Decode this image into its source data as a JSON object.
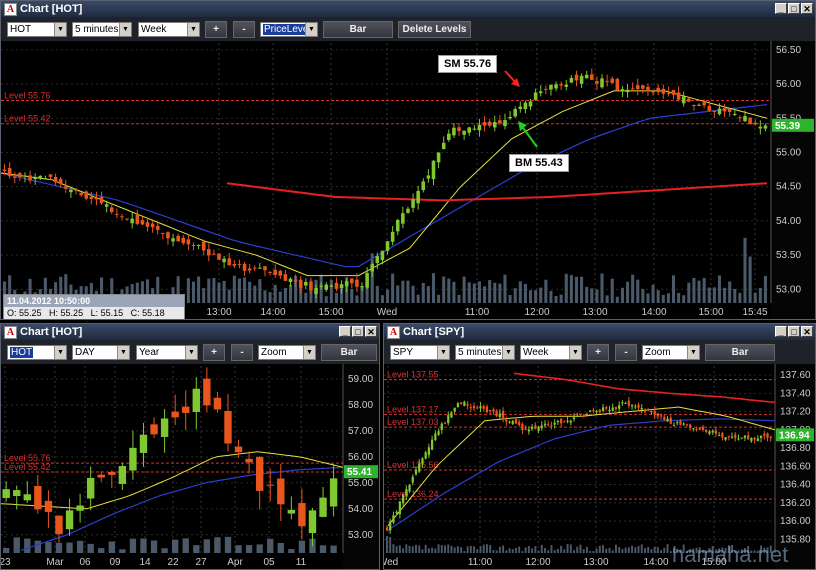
{
  "windows": {
    "main": {
      "title": "Chart [HOT]",
      "symbol": "HOT",
      "interval": "5 minutes",
      "range": "Week",
      "plus": "+",
      "minus": "-",
      "mode": "PriceLevel",
      "bar": "Bar",
      "delete": "Delete Levels",
      "price_ticks": [
        "56.50",
        "56.00",
        "55.50",
        "55.00",
        "54.50",
        "54.00",
        "53.50",
        "53.00"
      ],
      "price_tick_values": [
        56.5,
        56.0,
        55.5,
        55.0,
        54.5,
        54.0,
        53.5,
        53.0
      ],
      "time_ticks": [
        "13:00",
        "14:00",
        "15:00",
        "Wed",
        "11:00",
        "12:00",
        "13:00",
        "14:00",
        "15:00",
        "15:45"
      ],
      "levels": [
        {
          "label": "Level 55.76",
          "value": 55.76
        },
        {
          "label": "Level 55.42",
          "value": 55.42
        }
      ],
      "last_price": "55.39",
      "callout_sm": "SM 55.76",
      "callout_bm": "BM 55.43",
      "info": {
        "header": "11.04.2012 10:50:00",
        "o": "O: 55.25",
        "h": "H: 55.25",
        "l": "L: 55.15",
        "c": "C: 55.18"
      }
    },
    "bottom_left": {
      "title": "Chart [HOT]",
      "symbol": "HOT",
      "interval": "DAY",
      "range": "Year",
      "plus": "+",
      "minus": "-",
      "mode": "Zoom",
      "bar": "Bar",
      "price_ticks": [
        "59.00",
        "58.00",
        "57.00",
        "56.00",
        "55.00",
        "54.00",
        "53.00"
      ],
      "time_ticks": [
        "23",
        "Mar",
        "06",
        "09",
        "14",
        "22",
        "27",
        "Apr",
        "05",
        "11"
      ],
      "levels": [
        {
          "label": "Level 55.76",
          "value": 55.76
        },
        {
          "label": "Level 55.42",
          "value": 55.42
        }
      ],
      "last_price": "55.41"
    },
    "bottom_right": {
      "title": "Chart [SPY]",
      "symbol": "SPY",
      "interval": "5 minutes",
      "range": "Week",
      "plus": "+",
      "minus": "-",
      "mode": "Zoom",
      "bar": "Bar",
      "price_ticks": [
        "137.60",
        "137.40",
        "137.20",
        "137.00",
        "136.80",
        "136.60",
        "136.40",
        "136.20",
        "136.00",
        "135.80"
      ],
      "time_ticks": [
        "Wed",
        "11:00",
        "12:00",
        "13:00",
        "14:00",
        "15:00"
      ],
      "levels": [
        {
          "label": "Level 137.55",
          "value": 137.55
        },
        {
          "label": "Level 137.17",
          "value": 137.17
        },
        {
          "label": "Level 137.03",
          "value": 137.03
        },
        {
          "label": "Level 136.56",
          "value": 136.56
        },
        {
          "label": "Level 136.24",
          "value": 136.24
        }
      ],
      "last_price": "136.94"
    }
  },
  "watermark": "hamaha.net",
  "colors": {
    "bull": "#7fc832",
    "bear": "#e8561e",
    "level": "#d83030",
    "ma_fast": "#e8e03a",
    "ma_slow": "#2b3fd0",
    "volume": "#4a5a6a"
  },
  "chart_data": [
    {
      "type": "candlestick",
      "series": [
        {
          "name": "HOT 5 minutes",
          "approx_close_path": [
            54.7,
            54.6,
            54.3,
            54.0,
            53.7,
            53.4,
            53.2,
            53.0,
            53.1,
            54.2,
            55.3,
            55.4,
            55.9,
            56.1,
            55.9,
            55.8,
            55.6,
            55.4
          ]
        },
        {
          "name": "MA fast",
          "approx_path": [
            54.7,
            54.6,
            54.3,
            54.0,
            53.7,
            53.5,
            53.2,
            53.2,
            53.6,
            54.5,
            55.2,
            55.6,
            55.9,
            55.9,
            55.7,
            55.5
          ]
        },
        {
          "name": "MA slow",
          "approx_path": [
            54.7,
            54.5,
            54.3,
            54.0,
            53.7,
            53.5,
            53.3,
            53.8,
            54.3,
            54.8,
            55.2,
            55.5,
            55.6,
            55.7
          ]
        },
        {
          "name": "Daily MA",
          "approx_path": [
            54.55,
            54.35,
            54.3,
            54.35,
            54.45,
            54.55
          ]
        }
      ],
      "ylim": [
        52.8,
        56.6
      ]
    },
    {
      "type": "candlestick",
      "series": [
        {
          "name": "HOT DAY",
          "approx_close_path": [
            54.5,
            54.0,
            53.2,
            54.8,
            55.0,
            57.0,
            57.5,
            58.6,
            57.0,
            55.5,
            54.0,
            53.0,
            55.4
          ]
        }
      ],
      "ylim": [
        52.3,
        59.5
      ]
    },
    {
      "type": "candlestick",
      "series": [
        {
          "name": "SPY 5 minutes",
          "approx_close_path": [
            135.9,
            136.7,
            137.3,
            137.2,
            137.0,
            137.1,
            137.2,
            137.3,
            137.1,
            137.0,
            136.9,
            136.94
          ]
        }
      ],
      "ylim": [
        135.65,
        137.7
      ]
    }
  ]
}
